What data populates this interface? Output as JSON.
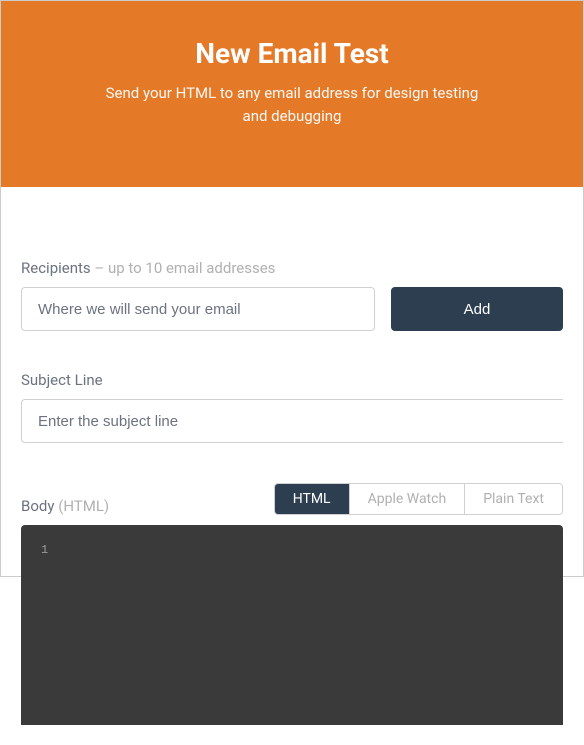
{
  "header": {
    "title": "New Email Test",
    "subtitle": "Send your HTML to any email address for design testing and debugging"
  },
  "recipients": {
    "label": "Recipients",
    "hint": " – up to 10 email addresses",
    "placeholder": "Where we will send your email",
    "add_label": "Add"
  },
  "subject": {
    "label": "Subject Line",
    "placeholder": "Enter the subject line"
  },
  "body": {
    "label": "Body",
    "hint": " (HTML)",
    "tabs": {
      "html": "HTML",
      "apple_watch": "Apple Watch",
      "plain_text": "Plain Text"
    },
    "editor_line": "1"
  }
}
